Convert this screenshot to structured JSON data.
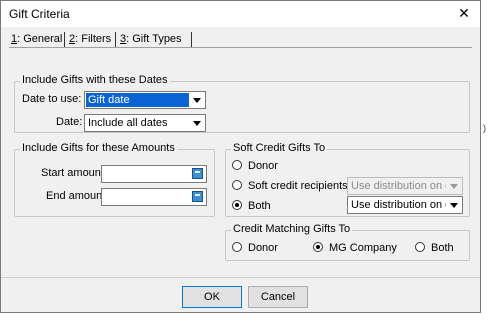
{
  "window": {
    "title": "Gift Criteria",
    "close_glyph": "✕"
  },
  "tabs": [
    {
      "key": "1",
      "label": ": General"
    },
    {
      "key": "2",
      "label": ": Filters"
    },
    {
      "key": "3",
      "label": ": Gift Types"
    }
  ],
  "dates": {
    "group_title": "Include Gifts with these Dates",
    "date_to_use_label": "Date to use:",
    "date_to_use_value": "Gift date",
    "date_label": "Date:",
    "date_value": "Include all dates"
  },
  "amounts": {
    "group_title": "Include Gifts for these Amounts",
    "start_label": "Start amount:",
    "start_value": "",
    "end_label": "End amount:",
    "end_value": ""
  },
  "soft_credit": {
    "group_title": "Soft Credit Gifts To",
    "options": [
      "Donor",
      "Soft credit recipients",
      "Both"
    ],
    "selected": "Both",
    "recipients_dist_value": "Use distribution on gift",
    "both_dist_value": "Use distribution on gift"
  },
  "matching": {
    "group_title": "Credit Matching Gifts To",
    "options": [
      "Donor",
      "MG Company",
      "Both"
    ],
    "selected": "MG Company"
  },
  "buttons": {
    "ok": "OK",
    "cancel": "Cancel"
  },
  "edge_fragment": ")"
}
